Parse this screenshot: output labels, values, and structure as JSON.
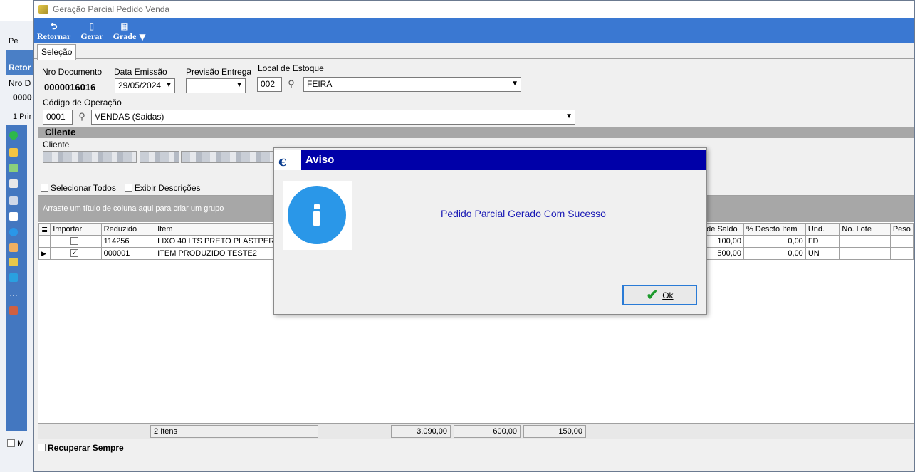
{
  "window": {
    "title": "Geração Parcial Pedido Venda",
    "tab": "Seleção"
  },
  "toolbar": {
    "buttons": [
      {
        "label": "Retornar",
        "icon": "return-icon"
      },
      {
        "label": "Gerar",
        "icon": "document-icon"
      },
      {
        "label": "Grade",
        "icon": "grid-icon"
      }
    ]
  },
  "background_window": {
    "tab_prefix": "Pe",
    "toolbar_label": "Retor",
    "field_label": "Nro D",
    "field_value": "0000",
    "tab_label": "1 Prir",
    "bottom_label": "M"
  },
  "form": {
    "nro_documento_label": "Nro Documento",
    "nro_documento": "0000016016",
    "data_emissao_label": "Data Emissão",
    "data_emissao": "29/05/2024",
    "previsao_entrega_label": "Previsão Entrega",
    "previsao_entrega": "",
    "local_estoque_label": "Local de Estoque",
    "local_estoque_code": "002",
    "local_estoque_name": "FEIRA",
    "codigo_operacao_label": "Código de Operação",
    "codigo_operacao_code": "0001",
    "codigo_operacao_name": "VENDAS (Saidas)",
    "cliente_section": "Cliente",
    "cliente_label": "Cliente"
  },
  "options": {
    "selecionar_todos": "Selecionar Todos",
    "exibir_descricoes": "Exibir Descrições"
  },
  "grid": {
    "group_hint": "Arraste um título de coluna aqui para criar um grupo",
    "columns_left": [
      "Importar",
      "Reduzido",
      "Item"
    ],
    "columns_right": [
      "de Saldo",
      "% Descto Item",
      "Und.",
      "No. Lote",
      "Peso"
    ],
    "rows": [
      {
        "importar": false,
        "reduzido": "114256",
        "item": "LIXO 40 LTS PRETO PLASTPERC",
        "saldo": "100,00",
        "desconto": "0,00",
        "und": "FD",
        "lote": "",
        "peso": ""
      },
      {
        "importar": true,
        "reduzido": "000001",
        "item": "ITEM PRODUZIDO TESTE2",
        "saldo": "500,00",
        "desconto": "0,00",
        "und": "UN",
        "lote": "",
        "peso": ""
      }
    ],
    "footer": {
      "count": "2 Itens",
      "total1": "3.090,00",
      "total2": "600,00",
      "total3": "150,00"
    }
  },
  "bottom": {
    "recuperar_sempre": "Recuperar Sempre"
  },
  "modal": {
    "title": "Aviso",
    "message": "Pedido Parcial Gerado Com Sucesso",
    "ok_label": "Ok"
  }
}
